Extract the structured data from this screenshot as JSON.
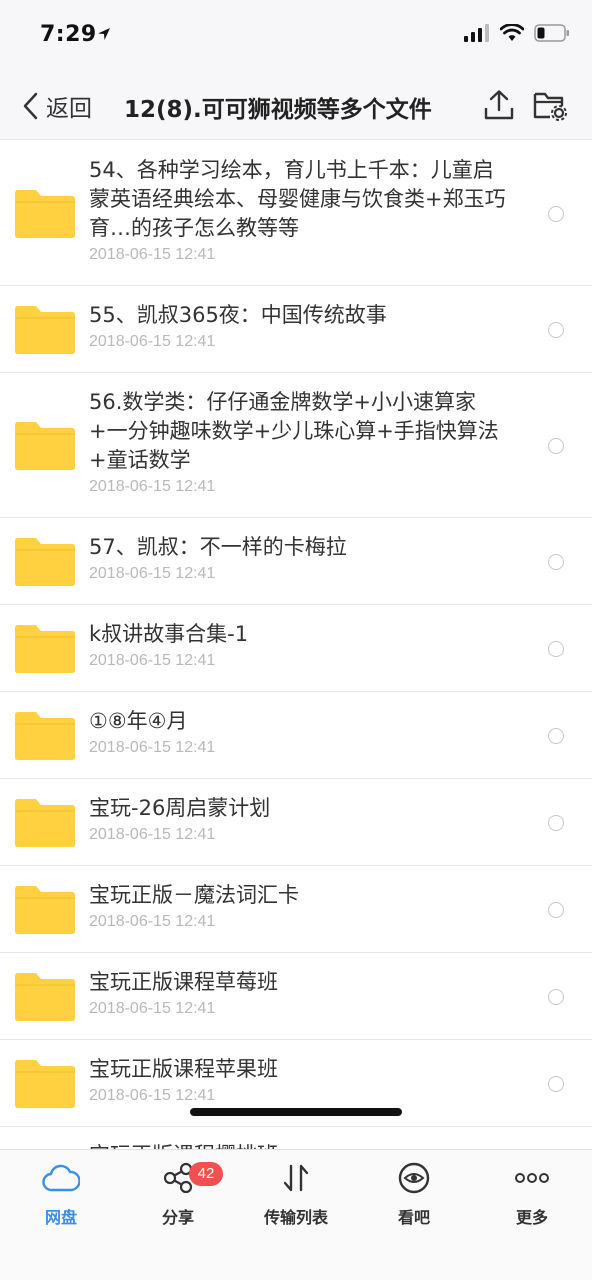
{
  "status": {
    "time": "7:29"
  },
  "nav": {
    "back_label": "返回",
    "title": "12(8).可可狮视频等多个文件"
  },
  "colors": {
    "folder": "#ffd03f",
    "accent": "#3a8ee6",
    "badge": "#f0504f"
  },
  "files": [
    {
      "name": "54、各种学习绘本，育儿书上千本：儿童启蒙英语经典绘本、母婴健康与饮食类+郑玉巧育…的孩子怎么教等等",
      "date": "2018-06-15 12:41"
    },
    {
      "name": "55、凯叔365夜：中国传统故事",
      "date": "2018-06-15 12:41"
    },
    {
      "name": "56.数学类：仔仔通金牌数学+小小速算家+一分钟趣味数学+少儿珠心算+手指快算法+童话数学",
      "date": "2018-06-15 12:41"
    },
    {
      "name": "57、凯叔：不一样的卡梅拉",
      "date": "2018-06-15 12:41"
    },
    {
      "name": "k叔讲故事合集-1",
      "date": "2018-06-15 12:41"
    },
    {
      "name": "①⑧年④月",
      "date": "2018-06-15 12:41"
    },
    {
      "name": "宝玩-26周启蒙计划",
      "date": "2018-06-15 12:41"
    },
    {
      "name": "宝玩正版－魔法词汇卡",
      "date": "2018-06-15 12:41"
    },
    {
      "name": "宝玩正版课程草莓班",
      "date": "2018-06-15 12:41"
    },
    {
      "name": "宝玩正版课程苹果班",
      "date": "2018-06-15 12:41"
    },
    {
      "name": "宝玩正版课程樱桃班",
      "date": ""
    }
  ],
  "tabs": [
    {
      "label": "网盘",
      "icon": "cloud-icon",
      "active": true
    },
    {
      "label": "分享",
      "icon": "share-icon",
      "badge": "42"
    },
    {
      "label": "传输列表",
      "icon": "transfer-icon"
    },
    {
      "label": "看吧",
      "icon": "eye-icon"
    },
    {
      "label": "更多",
      "icon": "more-icon"
    }
  ]
}
